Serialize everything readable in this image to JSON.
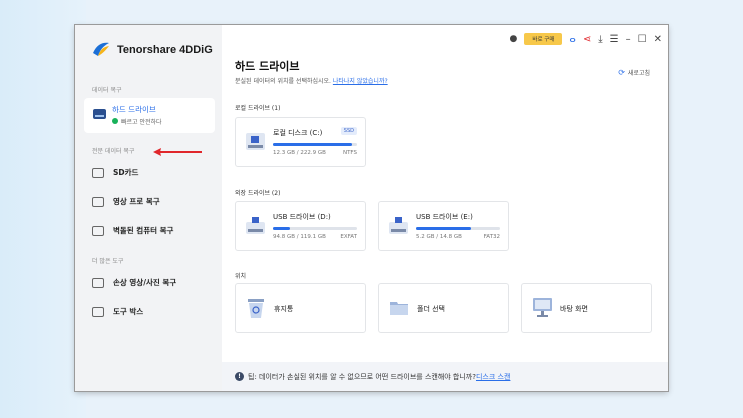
{
  "app": {
    "name": "Tenorshare 4DDiG",
    "buy_label": "바로 구매"
  },
  "sidebar": {
    "section1_label": "데이터 복구",
    "active_item": {
      "label": "하드 드라이브",
      "status": "빠르고 안전하다"
    },
    "section2_label": "전문 데이터 복구",
    "pro_items": [
      {
        "label": "SD카드",
        "icon": "sd-card-icon"
      },
      {
        "label": "영상 프로 복구",
        "icon": "video-icon"
      },
      {
        "label": "벽돌된 컴퓨터 복구",
        "icon": "computer-icon"
      }
    ],
    "section3_label": "더 많은 도구",
    "tool_items": [
      {
        "label": "손상 영상/사진 복구",
        "icon": "photo-repair-icon"
      },
      {
        "label": "도구 박스",
        "icon": "toolbox-icon"
      }
    ]
  },
  "main": {
    "title": "하드 드라이브",
    "subtitle": "분실된 데이터의 위치를 선택하십시오.",
    "subtitle_link": "나타나지 않았습니까?",
    "refresh_label": "새로고침",
    "local_group_label": "로컬 드라이브 (1)",
    "local_drives": [
      {
        "name": "로컬 디스크 (C:)",
        "badge": "SSD",
        "size": "12.3 GB / 222.9 GB",
        "fs": "NTFS",
        "used_fraction": 0.94
      }
    ],
    "external_group_label": "외장 드라이브 (2)",
    "external_drives": [
      {
        "name": "USB 드라이브 (D:)",
        "size": "94.8 GB / 119.1 GB",
        "fs": "EXFAT",
        "used_fraction": 0.2
      },
      {
        "name": "USB 드라이브 (E:)",
        "size": "5.2 GB / 14.8 GB",
        "fs": "FAT32",
        "used_fraction": 0.65
      }
    ],
    "location_group_label": "위치",
    "locations": [
      {
        "name": "휴지통",
        "icon": "recycle-bin-icon"
      },
      {
        "name": "폴더 선택",
        "icon": "folder-icon"
      },
      {
        "name": "바탕 화면",
        "icon": "desktop-icon"
      }
    ],
    "tip": "팁: 데이터가 손실된 위치를 알 수 없으므로 어떤 드라이브를 스캔해야 합니까?",
    "tip_link": "디스크 스캔"
  },
  "colors": {
    "accent": "#2a6ee8",
    "buy": "#f7c84a",
    "arrow": "#e0262b"
  }
}
